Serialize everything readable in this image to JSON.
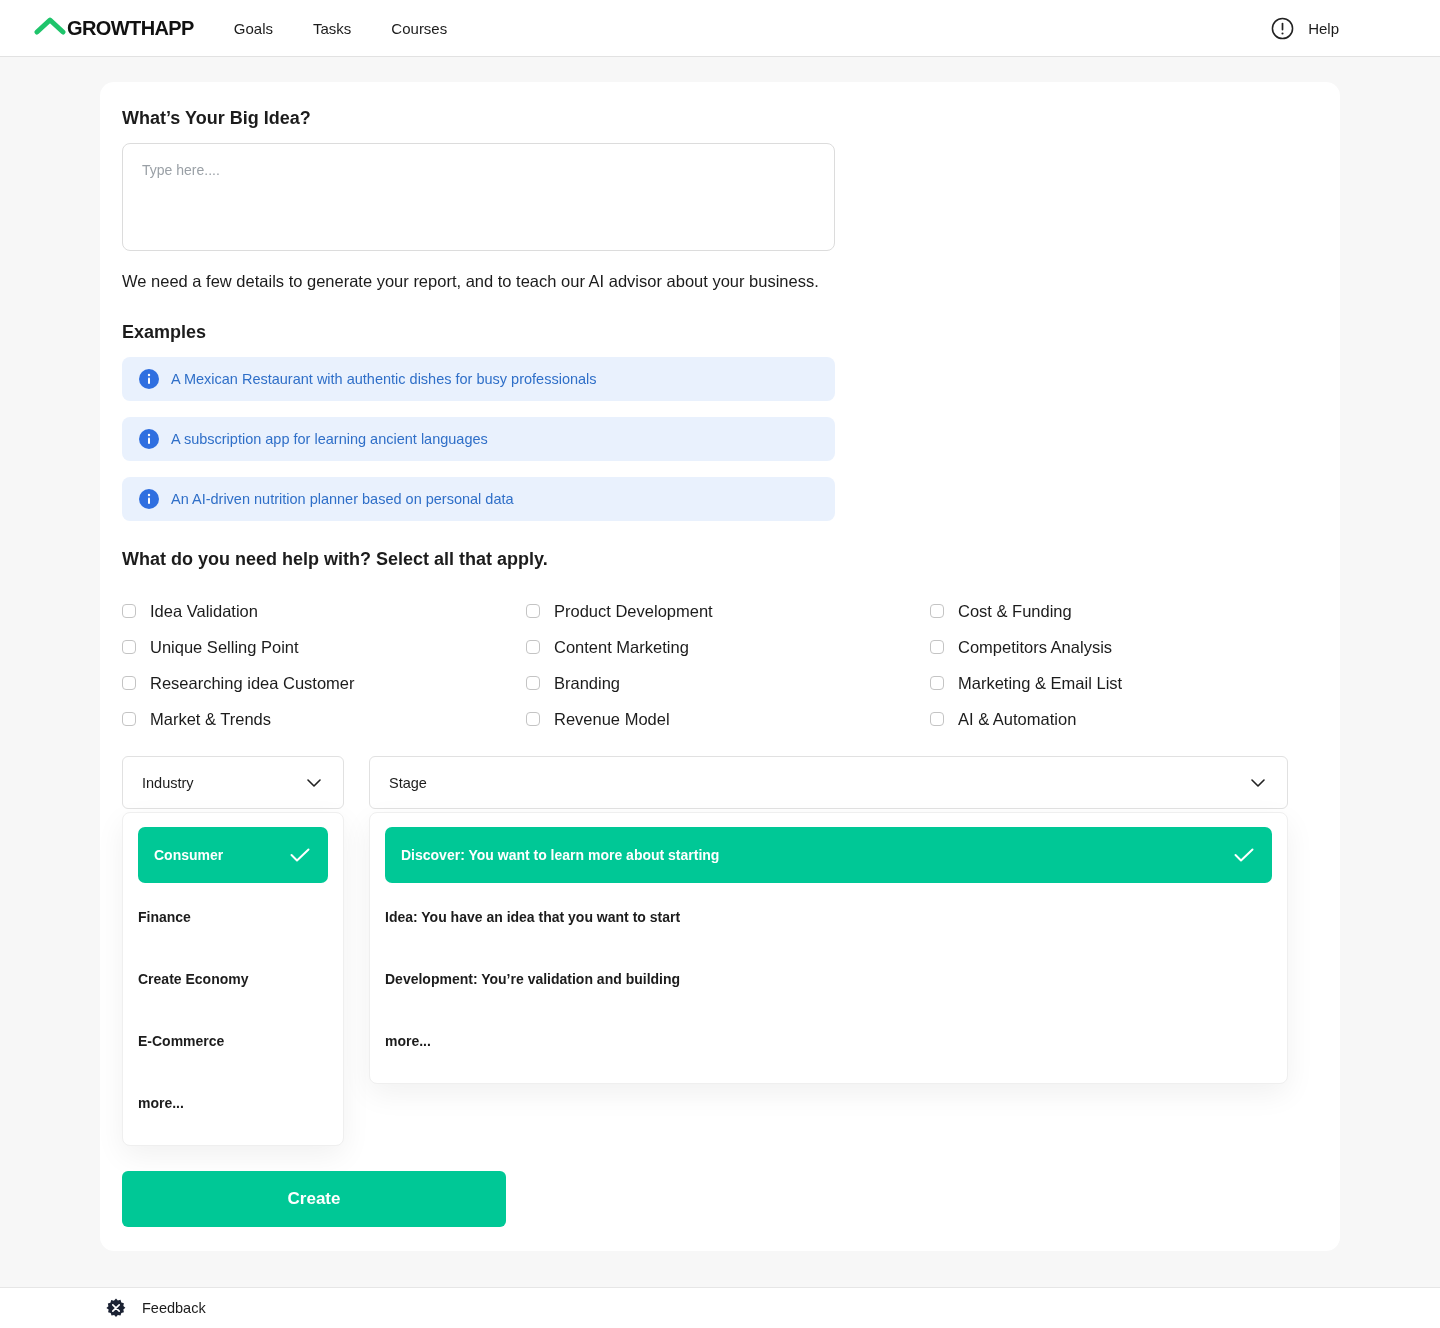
{
  "header": {
    "logo": "GROWTHAPP",
    "nav": [
      {
        "label": "Goals"
      },
      {
        "label": "Tasks"
      },
      {
        "label": "Courses"
      }
    ],
    "help": "Help"
  },
  "idea": {
    "title": "What’s Your Big Idea?",
    "placeholder": "Type here....",
    "note": "We need a few details to generate your report, and to teach our AI advisor about your business."
  },
  "examples": {
    "title": "Examples",
    "items": [
      "A Mexican Restaurant with authentic dishes for busy professionals",
      "A subscription app for learning ancient languages",
      "An AI-driven nutrition planner based on personal data"
    ]
  },
  "help_topics": {
    "title": "What do you need help with? Select all that apply.",
    "options": [
      {
        "label": "Idea Validation",
        "checked": false
      },
      {
        "label": "Product Development",
        "checked": false
      },
      {
        "label": "Cost & Funding",
        "checked": false
      },
      {
        "label": "Unique Selling Point",
        "checked": false
      },
      {
        "label": "Content Marketing",
        "checked": false
      },
      {
        "label": "Competitors Analysis",
        "checked": false
      },
      {
        "label": "Researching idea Customer",
        "checked": false
      },
      {
        "label": "Branding",
        "checked": false
      },
      {
        "label": "Marketing & Email List",
        "checked": false
      },
      {
        "label": "Market & Trends",
        "checked": false
      },
      {
        "label": "Revenue Model",
        "checked": false
      },
      {
        "label": "AI & Automation",
        "checked": false
      }
    ]
  },
  "dropdowns": [
    {
      "label": "Industry",
      "expanded": true,
      "options": [
        {
          "label": "Consumer",
          "selected": true
        },
        {
          "label": "Finance",
          "selected": false
        },
        {
          "label": "Create Economy",
          "selected": false
        },
        {
          "label": "E-Commerce",
          "selected": false
        },
        {
          "label": "more...",
          "selected": false
        }
      ]
    },
    {
      "label": "Stage",
      "expanded": true,
      "options": [
        {
          "label": "Discover: You want to learn more about starting",
          "selected": true
        },
        {
          "label": "Idea: You have an idea that you want to start",
          "selected": false
        },
        {
          "label": "Development: You’re validation and building",
          "selected": false
        },
        {
          "label": "more...",
          "selected": false
        }
      ]
    }
  ],
  "create_button": "Create",
  "footer": {
    "feedback": "Feedback"
  }
}
